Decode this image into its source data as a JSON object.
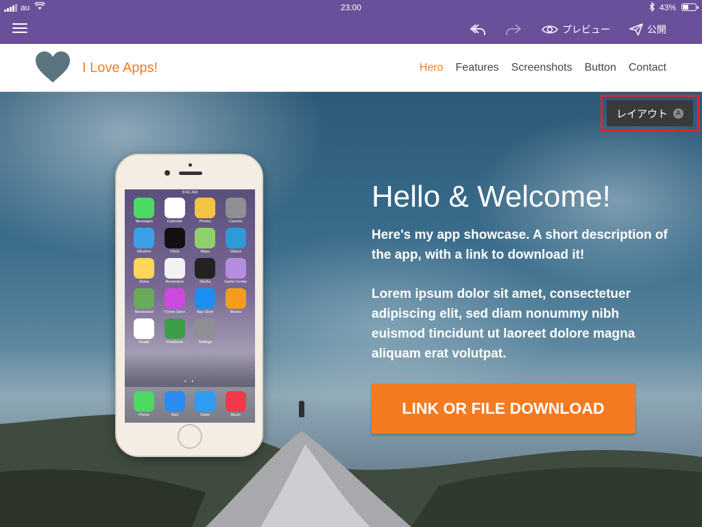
{
  "status_bar": {
    "carrier": "au",
    "time": "23:00",
    "battery_text": "43%",
    "battery_level": 0.43
  },
  "editor_toolbar": {
    "menu_icon": "hamburger-menu-icon",
    "undo_icon": "undo-icon",
    "redo_icon": "redo-icon",
    "preview_label": "プレビュー",
    "publish_label": "公開",
    "background_color": "#6a509a"
  },
  "site": {
    "brand": "I Love Apps!",
    "logo_icon": "heart-icon",
    "accent_color": "#ef7a2a",
    "nav": [
      {
        "label": "Hero",
        "active": true
      },
      {
        "label": "Features",
        "active": false
      },
      {
        "label": "Screenshots",
        "active": false
      },
      {
        "label": "Button",
        "active": false
      },
      {
        "label": "Contact",
        "active": false
      }
    ]
  },
  "layout_tab": {
    "label": "レイアウト",
    "badge": "A",
    "highlight_color": "#e0242b"
  },
  "hero": {
    "title": "Hello & Welcome!",
    "description": "Here's my app showcase. A short description of the app, with a link to download it!",
    "body": "Lorem ipsum dolor sit amet, consectetuer adipiscing elit, sed diam nonummy nibh euismod tincidunt ut laoreet dolore magna aliquam erat volutpat.",
    "cta_label": "LINK OR FILE DOWNLOAD",
    "cta_color": "#f47a20"
  },
  "phone_screen": {
    "status_time": "9:41 AM",
    "status_battery": "100%",
    "apps": [
      {
        "name": "Messages",
        "color": "#4cd964"
      },
      {
        "name": "Calendar",
        "color": "#ffffff"
      },
      {
        "name": "Photos",
        "color": "#f5c542"
      },
      {
        "name": "Camera",
        "color": "#8e8e93"
      },
      {
        "name": "Weather",
        "color": "#3aa0e8"
      },
      {
        "name": "Clock",
        "color": "#111111"
      },
      {
        "name": "Maps",
        "color": "#8fd06a"
      },
      {
        "name": "Videos",
        "color": "#2d9bd6"
      },
      {
        "name": "Notes",
        "color": "#fbd75b"
      },
      {
        "name": "Reminders",
        "color": "#f2f2f2"
      },
      {
        "name": "Stocks",
        "color": "#222222"
      },
      {
        "name": "Game Center",
        "color": "#b58de0"
      },
      {
        "name": "Newsstand",
        "color": "#6aaa5a"
      },
      {
        "name": "iTunes Store",
        "color": "#c94bdd"
      },
      {
        "name": "App Store",
        "color": "#1e8ef0"
      },
      {
        "name": "iBooks",
        "color": "#f39c1e"
      },
      {
        "name": "Health",
        "color": "#ffffff"
      },
      {
        "name": "Passbook",
        "color": "#3d9e4a"
      },
      {
        "name": "Settings",
        "color": "#8e8e93"
      }
    ],
    "dock": [
      {
        "name": "Phone",
        "color": "#4cd964"
      },
      {
        "name": "Mail",
        "color": "#2d8cf0"
      },
      {
        "name": "Safari",
        "color": "#2f9cf2"
      },
      {
        "name": "Music",
        "color": "#f2394b"
      }
    ]
  }
}
